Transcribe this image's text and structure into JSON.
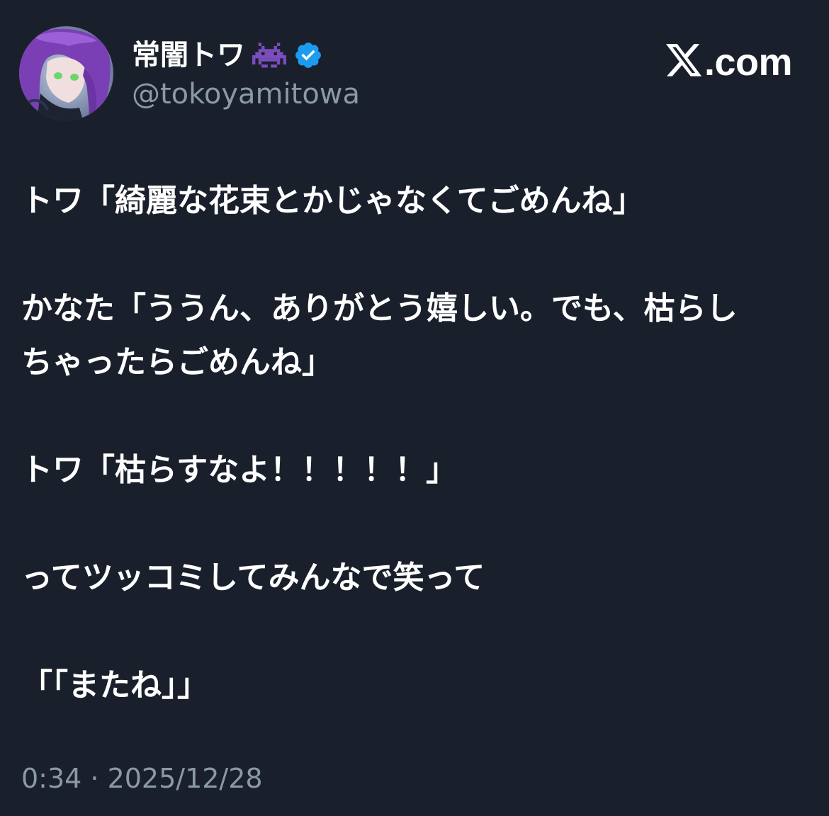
{
  "author": {
    "display_name": "常闇トワ",
    "name_emoji_icon": "space-invader-icon",
    "verified_icon": "verified-badge-icon",
    "handle": "@tokoyamitowa",
    "avatar_icon": "avatar-illustration"
  },
  "brand": {
    "logo_icon": "x-logo-icon",
    "text": ".com"
  },
  "tweet": {
    "lines": [
      "トワ「綺麗な花束とかじゃなくてごめんね」",
      "",
      "かなた「ううん、ありがとう嬉しい。でも、枯らし",
      "ちゃったらごめんね」",
      "",
      "トワ「枯らすなよ！！！！！」",
      "",
      "ってツッコミしてみんなで笑って",
      "",
      "「「またね」」"
    ]
  },
  "timestamp": "0:34 · 2025/12/28",
  "colors": {
    "background": "#1a202b",
    "text_primary": "#ffffff",
    "text_secondary": "#8b98a5",
    "verified_blue": "#1d9bf0",
    "emoji_purple": "#7c4dbe"
  }
}
